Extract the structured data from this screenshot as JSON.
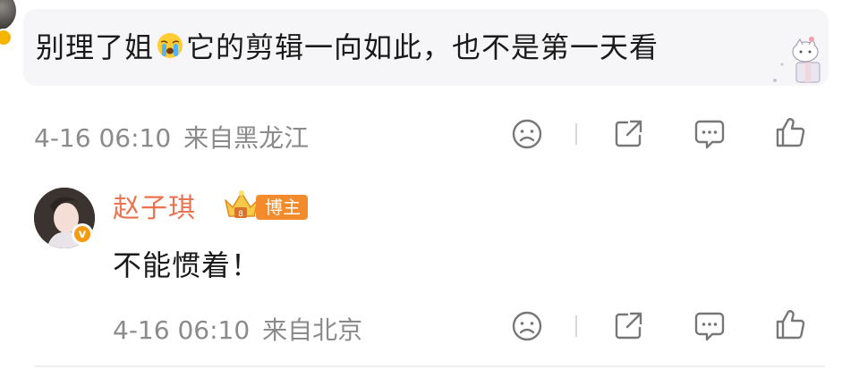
{
  "comment": {
    "text_before_emoji": "别理了姐",
    "emoji": "crying-emoji",
    "text_after_emoji": "它的剪辑一向如此，也不是第一天看",
    "date": "4-16 06:10",
    "location": "来自黑龙江"
  },
  "reply": {
    "author": "赵子琪",
    "badge": "博主",
    "text": "不能惯着！",
    "date": "4-16 06:10",
    "location": "来自北京"
  },
  "actions": [
    "sad-face-icon",
    "share-icon",
    "comment-icon",
    "like-icon"
  ],
  "colors": {
    "author_name": "#eb7350",
    "badge_bg": "#f38b2c",
    "meta_text": "#8b8b8b",
    "bubble_bg": "#f6f5f7"
  }
}
